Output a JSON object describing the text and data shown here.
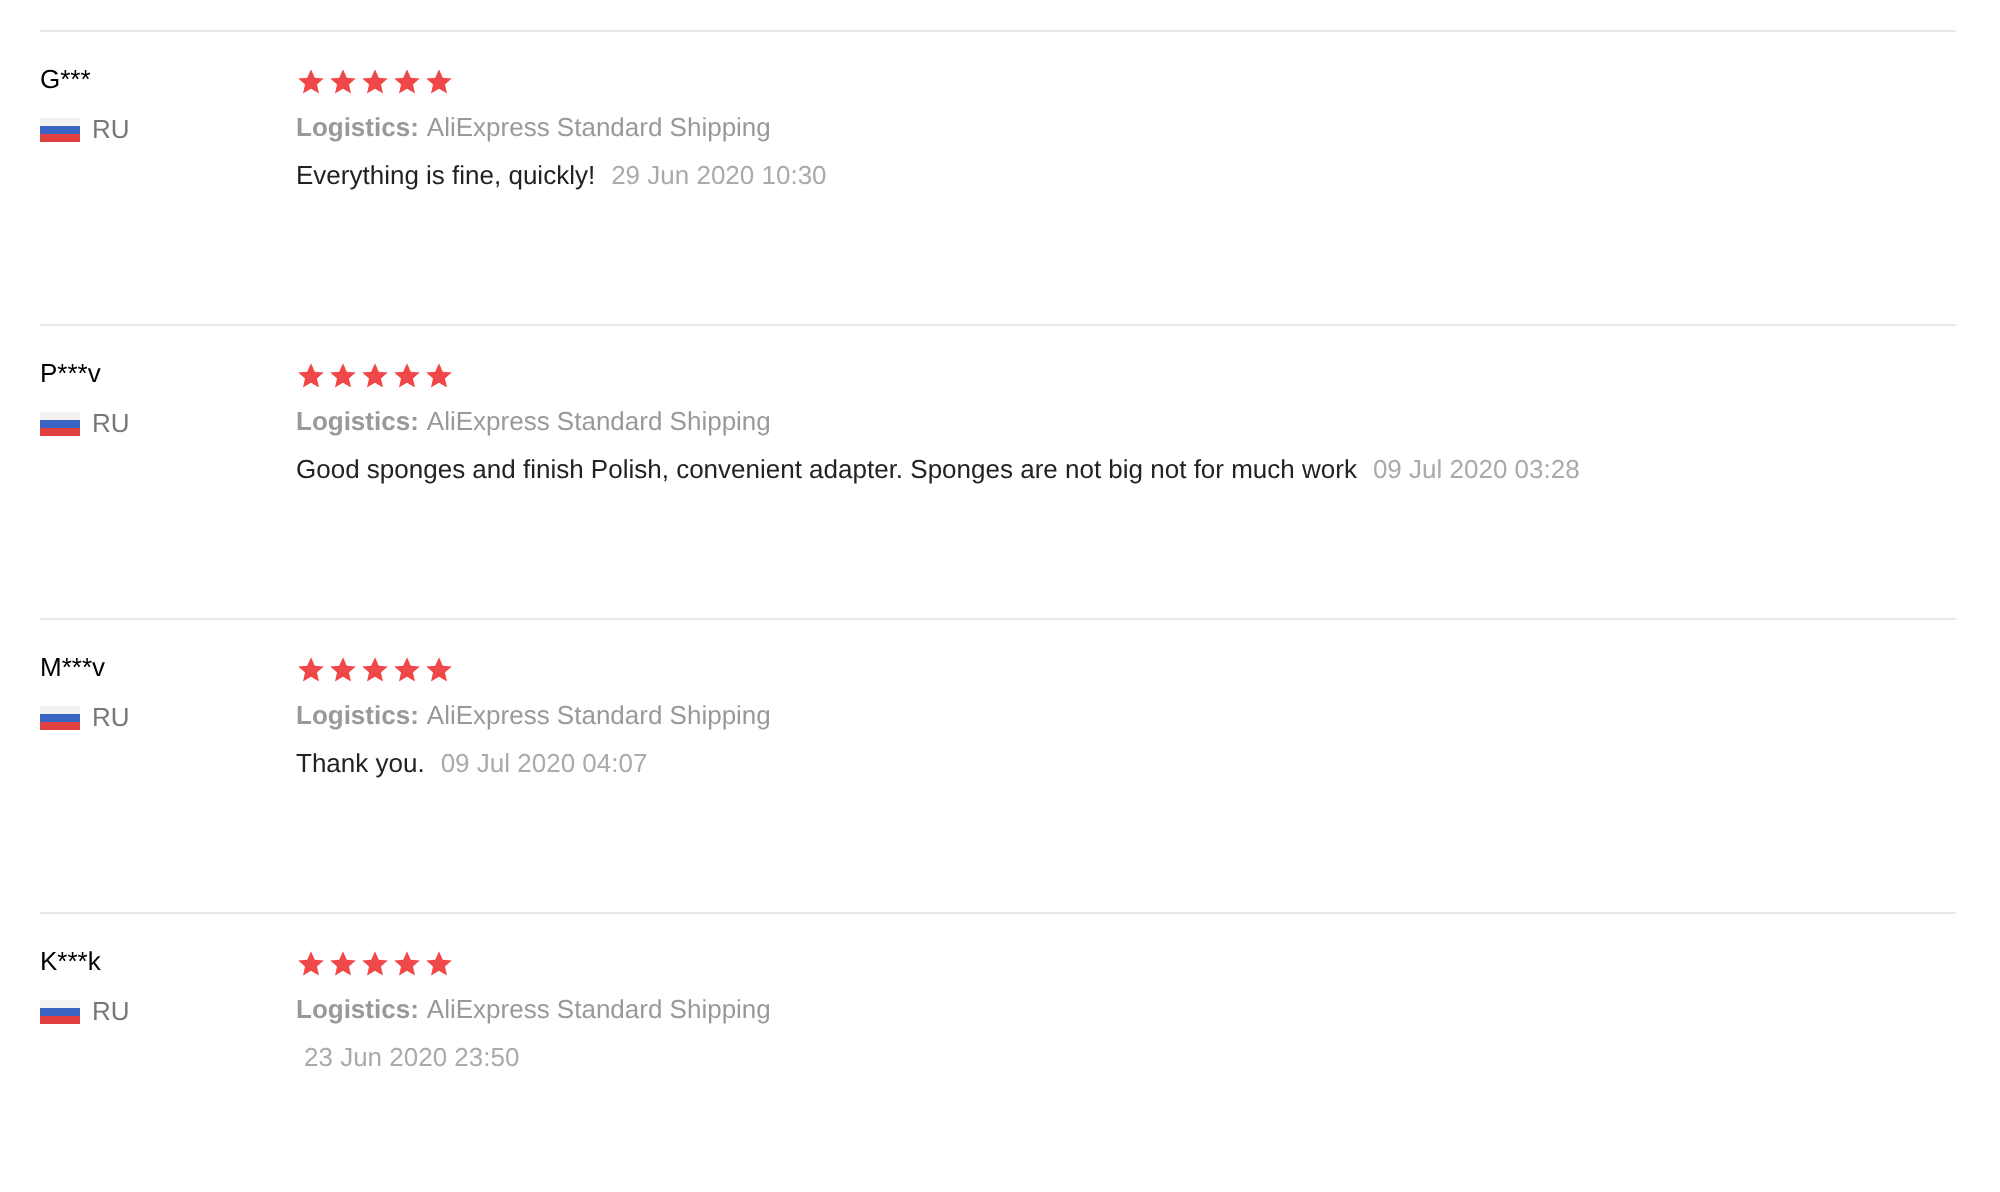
{
  "reviews": [
    {
      "name": "G***",
      "country": "RU",
      "stars": 5,
      "logistics_label": "Logistics:",
      "logistics_value": "AliExpress Standard Shipping",
      "comment": "Everything is fine, quickly!",
      "date": "29 Jun 2020 10:30"
    },
    {
      "name": "P***v",
      "country": "RU",
      "stars": 5,
      "logistics_label": "Logistics:",
      "logistics_value": "AliExpress Standard Shipping",
      "comment": "Good sponges and finish Polish, convenient adapter. Sponges are not big not for much work",
      "date": "09 Jul 2020 03:28"
    },
    {
      "name": "M***v",
      "country": "RU",
      "stars": 5,
      "logistics_label": "Logistics:",
      "logistics_value": "AliExpress Standard Shipping",
      "comment": "Thank you.",
      "date": "09 Jul 2020 04:07"
    },
    {
      "name": "K***k",
      "country": "RU",
      "stars": 5,
      "logistics_label": "Logistics:",
      "logistics_value": "AliExpress Standard Shipping",
      "date": "23 Jun 2020 23:50"
    }
  ]
}
